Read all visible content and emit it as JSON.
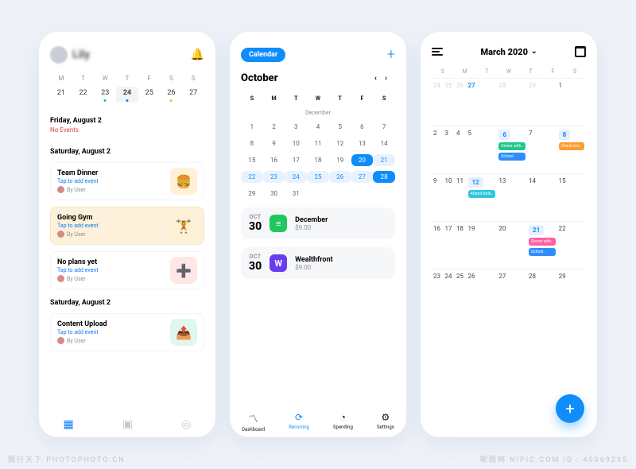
{
  "watermark_left": "图行天下 PHOTOPHOTO.CN",
  "watermark_right": "昵图网 NIPIC.COM  ID : 40069295",
  "p1": {
    "username": "Lily",
    "weekdays": [
      "M",
      "T",
      "W",
      "T",
      "F",
      "S",
      "S"
    ],
    "dates": [
      "21",
      "22",
      "23",
      "24",
      "25",
      "26",
      "27"
    ],
    "sec1_title": "Friday, August 2",
    "sec1_sub": "No Events",
    "sec2_title": "Saturday, August 2",
    "events": [
      {
        "title": "Team Dinner",
        "sub": "Tap to add event",
        "by": "By User"
      },
      {
        "title": "Going Gym",
        "sub": "Tap to add event",
        "by": "By User"
      },
      {
        "title": "No plans yet",
        "sub": "Tap to add event",
        "by": "By User"
      }
    ],
    "sec3_title": "Saturday, August 2",
    "events2": [
      {
        "title": "Content Upload",
        "sub": "Tap to add event",
        "by": "By User"
      }
    ]
  },
  "p2": {
    "pill": "Calendar",
    "month": "October",
    "mini": "December",
    "wk": [
      "S",
      "M",
      "T",
      "W",
      "T",
      "F",
      "S"
    ],
    "grid": [
      "1",
      "2",
      "3",
      "4",
      "5",
      "6",
      "7",
      "8",
      "9",
      "10",
      "11",
      "12",
      "13",
      "14",
      "15",
      "16",
      "17",
      "18",
      "19",
      "20",
      "21",
      "22",
      "23",
      "24",
      "25",
      "26",
      "27",
      "28",
      "29",
      "30",
      "31",
      ""
    ],
    "t1": {
      "m": "OCT",
      "d": "30",
      "title": "December",
      "amt": "$9.00"
    },
    "t2": {
      "m": "OCT",
      "d": "30",
      "title": "Wealthfront",
      "amt": "$9.00"
    },
    "tabs": [
      "Dashboard",
      "Recurring",
      "Spending",
      "Settings"
    ]
  },
  "p3": {
    "title": "March 2020",
    "wk": [
      "S",
      "M",
      "T",
      "W",
      "T",
      "F",
      "S"
    ],
    "row1": [
      "24",
      "25",
      "26",
      "27",
      "28",
      "29",
      "1"
    ],
    "row2": [
      "2",
      "3",
      "4",
      "5",
      "6",
      "7",
      "8"
    ],
    "row3": [
      "9",
      "10",
      "11",
      "12",
      "13",
      "14",
      "15"
    ],
    "row4": [
      "16",
      "17",
      "18",
      "19",
      "20",
      "21",
      "22"
    ],
    "row5": [
      "23",
      "24",
      "25",
      "26",
      "27",
      "28",
      "29"
    ],
    "chips": {
      "d6a": "Dinner with..",
      "d6b": "School..",
      "d8": "Check emt..",
      "d12": "Attend birth..",
      "d21a": "Dinner with..",
      "d21b": "School.."
    }
  }
}
